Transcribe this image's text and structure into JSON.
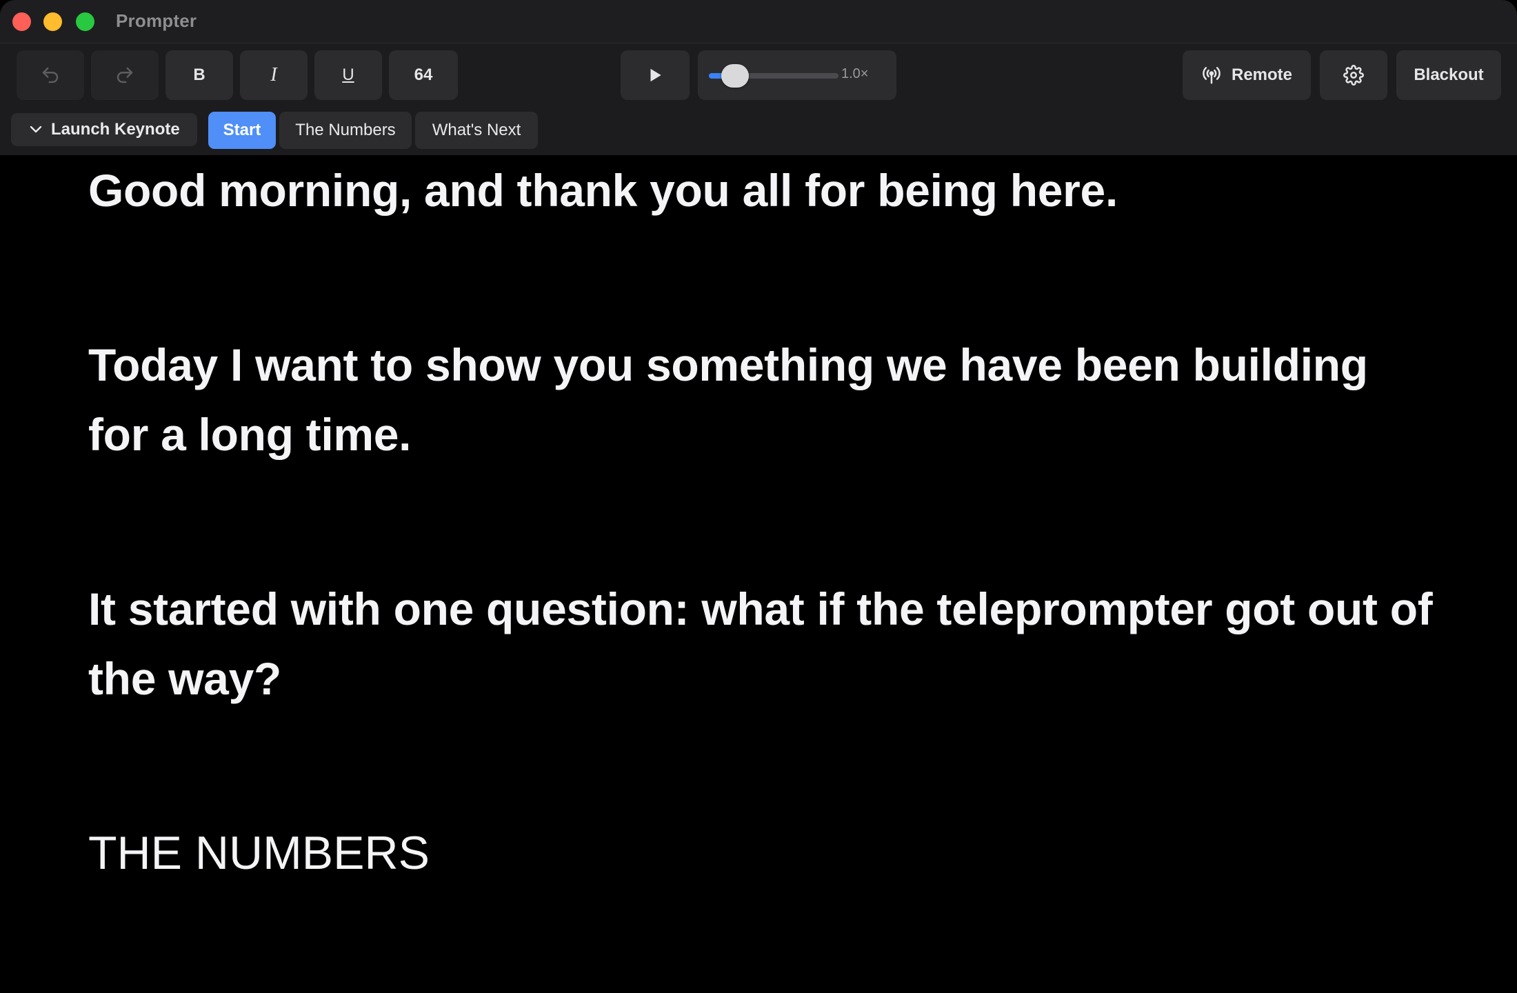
{
  "window": {
    "title": "Prompter"
  },
  "toolbar": {
    "bold_label": "B",
    "italic_label": "I",
    "underline_label": "U",
    "font_size": "64",
    "speed": {
      "value": 0.2,
      "label": "1.0×"
    },
    "remote_label": "Remote",
    "blackout_label": "Blackout"
  },
  "sections": {
    "dropdown_label": "Launch Keynote",
    "items": [
      {
        "label": "Start",
        "active": true
      },
      {
        "label": "The Numbers",
        "active": false
      },
      {
        "label": "What's Next",
        "active": false
      }
    ]
  },
  "script": {
    "paragraphs": [
      "Good morning, and thank you all for being here.",
      "Today I want to show you something we have been building for a long time.",
      "It started with one question: what if the teleprompter got out of the way?"
    ],
    "heading": "THE NUMBERS"
  },
  "colors": {
    "accent": "#4f8ff7",
    "background": "#000000",
    "text": "#f4f4f6"
  }
}
